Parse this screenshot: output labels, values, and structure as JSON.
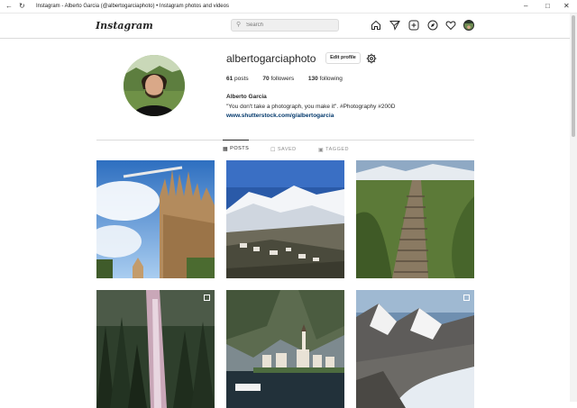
{
  "window": {
    "title": "Instagram - Alberto Garcia (@albertogarciaphoto) • Instagram photos and videos"
  },
  "header": {
    "logo": "Instagram",
    "search_placeholder": "Search",
    "nav_icons": [
      "home-icon",
      "direct-message-icon",
      "new-post-icon",
      "explore-icon",
      "activity-heart-icon"
    ]
  },
  "profile": {
    "username": "albertogarciaphoto",
    "edit_label": "Edit profile",
    "stats": {
      "posts_count": "61",
      "posts_label": "posts",
      "followers_count": "70",
      "followers_label": "followers",
      "following_count": "130",
      "following_label": "following"
    },
    "full_name": "Alberto Garcia",
    "bio": "\"You don't take a photograph, you make it\". #Photography #200D",
    "link": "www.shutterstock.com/g/albertogarcia"
  },
  "tabs": [
    {
      "label": "POSTS",
      "icon": "grid-icon",
      "active": true
    },
    {
      "label": "SAVED",
      "icon": "bookmark-icon",
      "active": false
    },
    {
      "label": "TAGGED",
      "icon": "tag-icon",
      "active": false
    }
  ],
  "posts": [
    {
      "subject": "Sagrada Familia towers",
      "multi": false
    },
    {
      "subject": "snowy mountain village",
      "multi": false
    },
    {
      "subject": "stone stairway on green hill",
      "multi": false
    },
    {
      "subject": "waterfall in forest",
      "multi": true
    },
    {
      "subject": "lakeside village with church",
      "multi": false
    },
    {
      "subject": "alpine glacier valley",
      "multi": true
    }
  ],
  "colors": {
    "accent": "#262626",
    "link": "#00376b",
    "border": "#dbdbdb"
  }
}
